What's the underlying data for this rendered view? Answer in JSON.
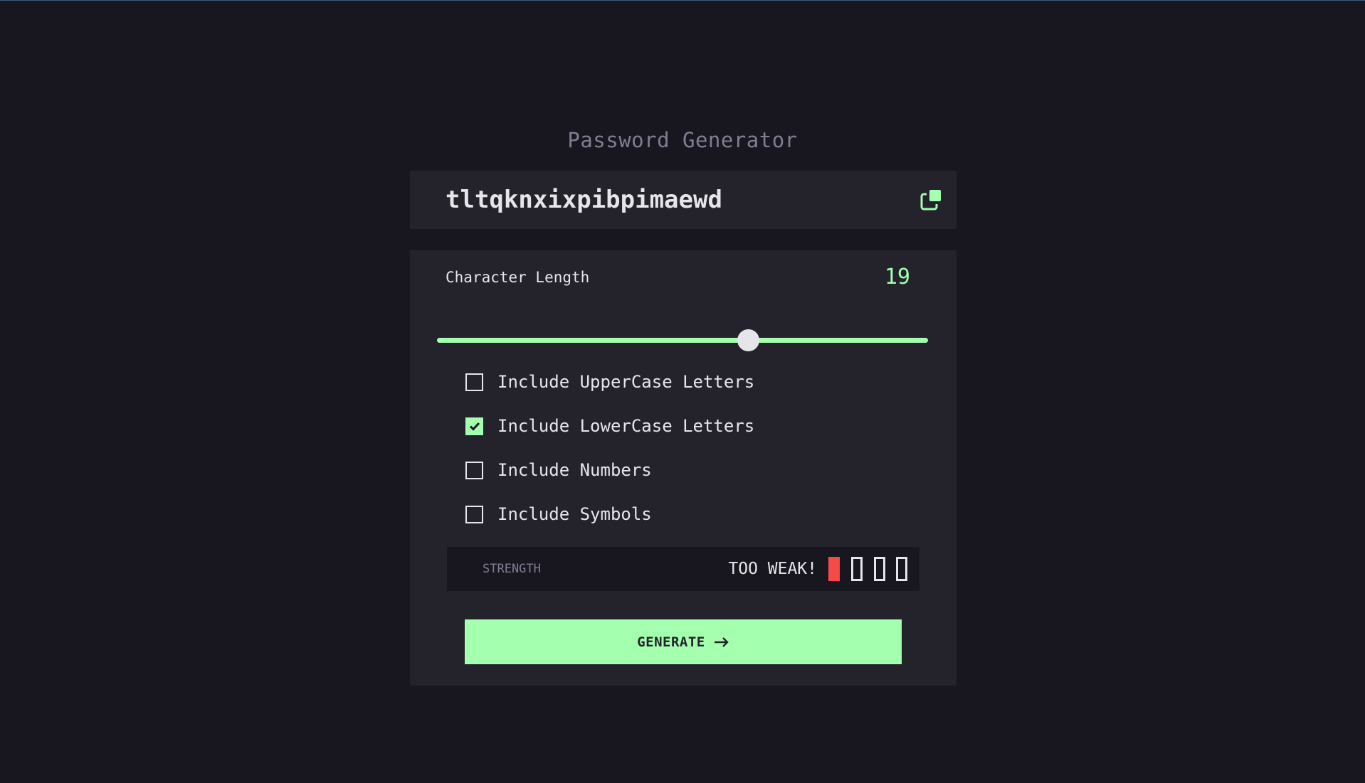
{
  "app": {
    "title": "Password Generator"
  },
  "password": {
    "value": "tltqknxixpibpimaewd",
    "copy_icon": "copy-icon"
  },
  "length": {
    "label": "Character Length",
    "value": "19",
    "slider_fraction": 0.64
  },
  "options": [
    {
      "label": "Include UpperCase Letters",
      "checked": false
    },
    {
      "label": "Include LowerCase Letters",
      "checked": true
    },
    {
      "label": "Include Numbers",
      "checked": false
    },
    {
      "label": "Include Symbols",
      "checked": false
    }
  ],
  "strength": {
    "label": "STRENGTH",
    "value": "TOO WEAK!",
    "level": 1,
    "max_level": 4
  },
  "generate": {
    "label": "GENERATE",
    "icon": "arrow-right-icon"
  },
  "colors": {
    "background": "#18171f",
    "panel": "#24232c",
    "accent": "#a4ffaf",
    "text": "#e6e5ea",
    "muted": "#817d92",
    "weak": "#f64a4a"
  }
}
